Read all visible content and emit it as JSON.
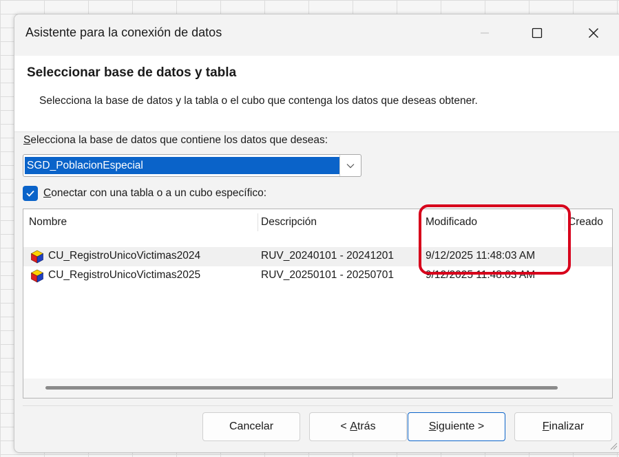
{
  "window": {
    "title": "Asistente para la conexión de datos"
  },
  "header": {
    "title": "Seleccionar base de datos y tabla",
    "description": "Selecciona la base de datos y la tabla o el cubo que contenga los datos que deseas obtener."
  },
  "database": {
    "label_access": "S",
    "label_rest": "elecciona la base de datos que contiene los datos que deseas:",
    "selected": "SGD_PoblacionEspecial"
  },
  "connect_checkbox": {
    "checked": true,
    "label_access": "C",
    "label_rest": "onectar con una tabla o a un cubo específico:"
  },
  "table": {
    "columns": [
      "Nombre",
      "Descripción",
      "Modificado",
      "Creado"
    ],
    "rows": [
      {
        "name": "CU_RegistroUnicoVictimas2024",
        "description": "RUV_20240101 - 20241201",
        "modified": "9/12/2025 11:48:03 AM",
        "created": ""
      },
      {
        "name": "CU_RegistroUnicoVictimas2025",
        "description": "RUV_20250101 - 20250701",
        "modified": "9/12/2025 11:48:03 AM",
        "created": ""
      }
    ],
    "row_icon": "cube-icon"
  },
  "buttons": {
    "cancel": "Cancelar",
    "back_prefix": "< ",
    "back_access": "A",
    "back_rest": "trás",
    "next_access": "S",
    "next_rest": "iguiente >",
    "finish_access": "F",
    "finish_rest": "inalizar"
  },
  "colors": {
    "accent": "#0a63c9",
    "highlight": "#d7001b"
  }
}
